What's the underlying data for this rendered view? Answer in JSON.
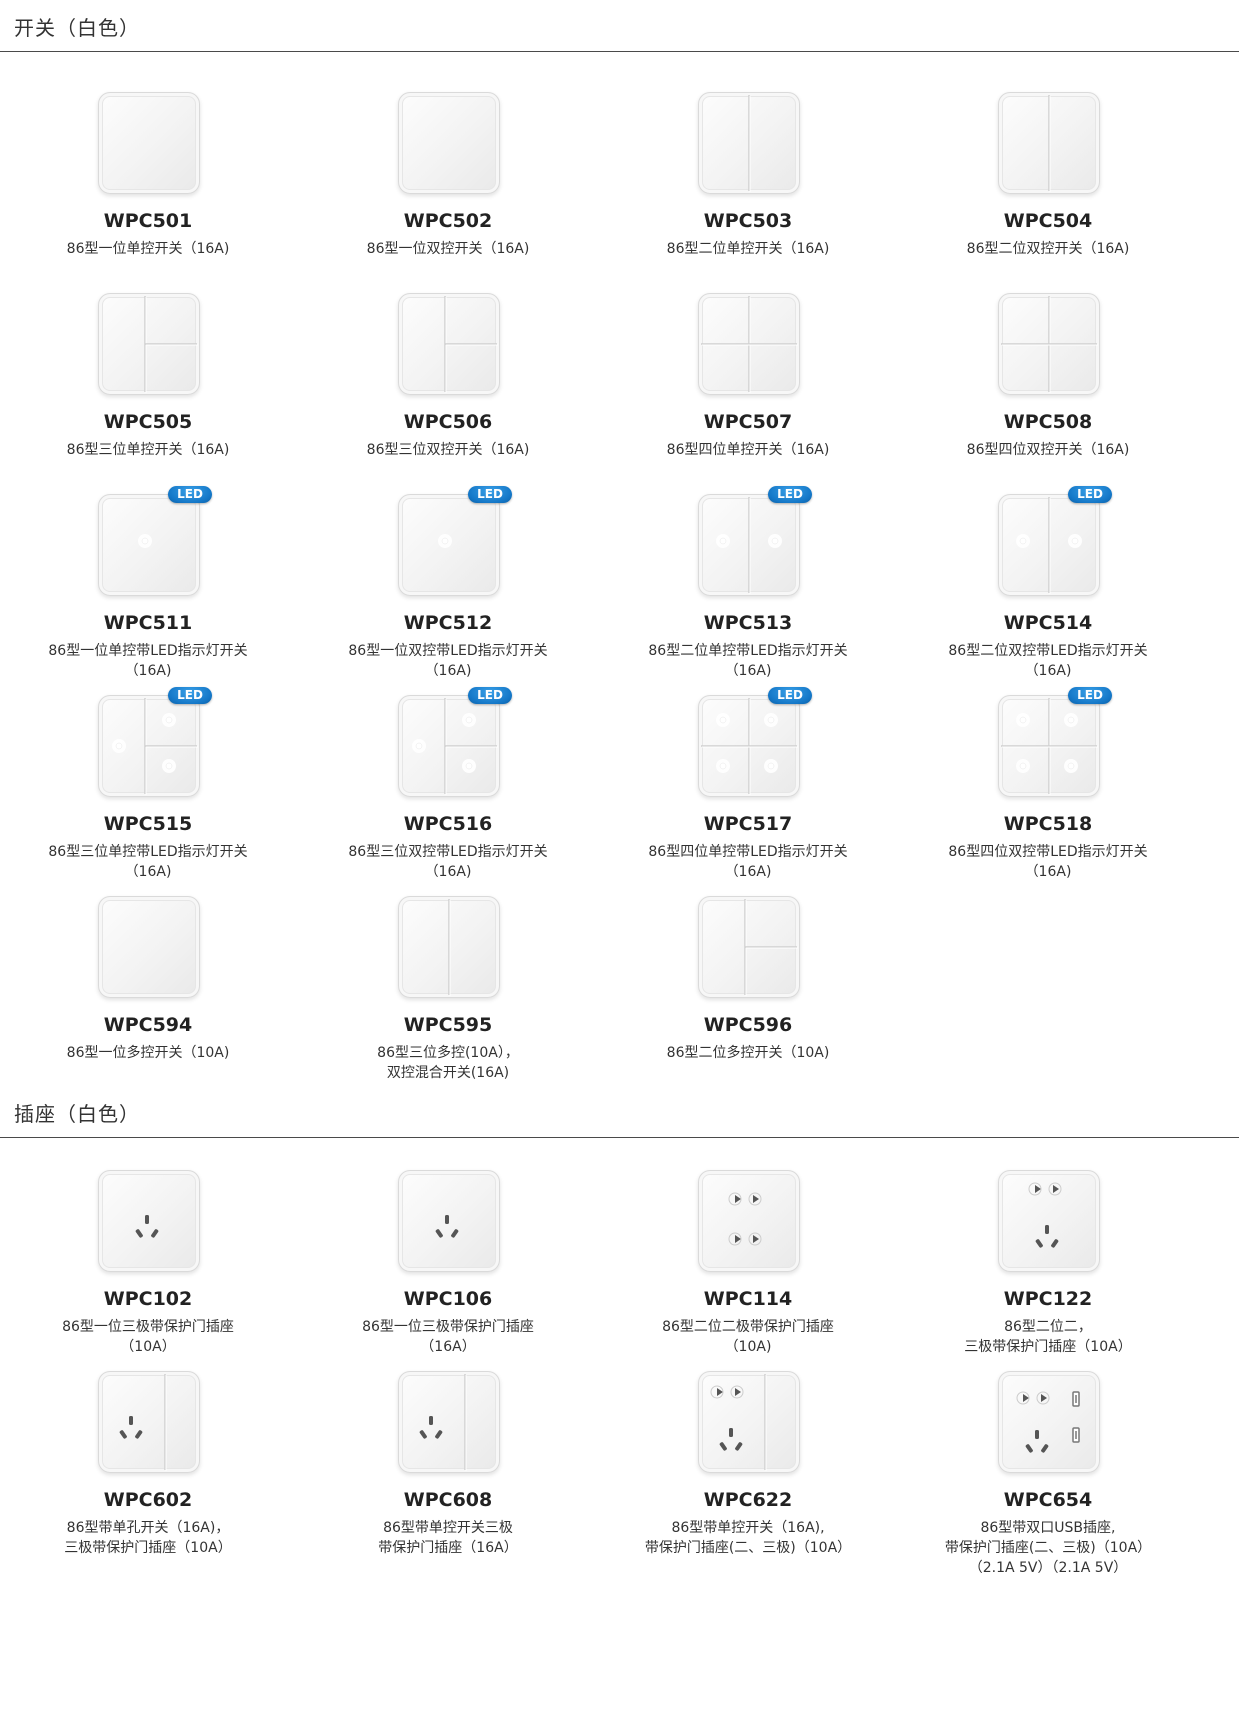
{
  "sections": [
    {
      "title": "开关（白色）",
      "products": [
        {
          "model": "WPC501",
          "desc": "86型一位单控开关（16A)",
          "led": false,
          "icon": "switch-1gang-icon"
        },
        {
          "model": "WPC502",
          "desc": "86型一位双控开关（16A)",
          "led": false,
          "icon": "switch-1gang-icon"
        },
        {
          "model": "WPC503",
          "desc": "86型二位单控开关（16A)",
          "led": false,
          "icon": "switch-2gang-icon"
        },
        {
          "model": "WPC504",
          "desc": "86型二位双控开关（16A)",
          "led": false,
          "icon": "switch-2gang-icon"
        },
        {
          "model": "WPC505",
          "desc": "86型三位单控开关（16A)",
          "led": false,
          "icon": "switch-3gang-icon"
        },
        {
          "model": "WPC506",
          "desc": "86型三位双控开关（16A)",
          "led": false,
          "icon": "switch-3gang-icon"
        },
        {
          "model": "WPC507",
          "desc": "86型四位单控开关（16A)",
          "led": false,
          "icon": "switch-4gang-icon"
        },
        {
          "model": "WPC508",
          "desc": "86型四位双控开关（16A)",
          "led": false,
          "icon": "switch-4gang-icon"
        },
        {
          "model": "WPC511",
          "desc": "86型一位单控带LED指示灯开关\n（16A)",
          "led": true,
          "icon": "switch-1gang-led-icon"
        },
        {
          "model": "WPC512",
          "desc": "86型一位双控带LED指示灯开关\n（16A)",
          "led": true,
          "icon": "switch-1gang-led-icon"
        },
        {
          "model": "WPC513",
          "desc": "86型二位单控带LED指示灯开关\n（16A)",
          "led": true,
          "icon": "switch-2gang-led-icon"
        },
        {
          "model": "WPC514",
          "desc": "86型二位双控带LED指示灯开关\n（16A)",
          "led": true,
          "icon": "switch-2gang-led-icon"
        },
        {
          "model": "WPC515",
          "desc": "86型三位单控带LED指示灯开关\n（16A)",
          "led": true,
          "icon": "switch-3gang-led-icon"
        },
        {
          "model": "WPC516",
          "desc": "86型三位双控带LED指示灯开关\n（16A)",
          "led": true,
          "icon": "switch-3gang-led-icon"
        },
        {
          "model": "WPC517",
          "desc": "86型四位单控带LED指示灯开关\n（16A)",
          "led": true,
          "icon": "switch-4gang-led-icon"
        },
        {
          "model": "WPC518",
          "desc": "86型四位双控带LED指示灯开关\n（16A)",
          "led": true,
          "icon": "switch-4gang-led-icon"
        },
        {
          "model": "WPC594",
          "desc": "86型一位多控开关（10A)",
          "led": false,
          "icon": "switch-1gang-icon"
        },
        {
          "model": "WPC595",
          "desc": "86型三位多控(10A），\n双控混合开关(16A)",
          "led": false,
          "icon": "switch-2gang-icon"
        },
        {
          "model": "WPC596",
          "desc": "86型二位多控开关（10A)",
          "led": false,
          "icon": "switch-3gang-icon"
        }
      ]
    },
    {
      "title": "插座（白色）",
      "products": [
        {
          "model": "WPC102",
          "desc": "86型一位三极带保护门插座\n（10A）",
          "led": false,
          "icon": "socket-3pin-icon"
        },
        {
          "model": "WPC106",
          "desc": "86型一位三极带保护门插座\n（16A）",
          "led": false,
          "icon": "socket-3pin-icon"
        },
        {
          "model": "WPC114",
          "desc": "86型二位二极带保护门插座\n（10A)",
          "led": false,
          "icon": "socket-2x2pin-icon"
        },
        {
          "model": "WPC122",
          "desc": "86型二位二，\n三极带保护门插座（10A）",
          "led": false,
          "icon": "socket-2pin-3pin-icon"
        },
        {
          "model": "WPC602",
          "desc": "86型带单孔开关（16A)，\n三极带保护门插座（10A）",
          "led": false,
          "icon": "switch-socket-3pin-icon"
        },
        {
          "model": "WPC608",
          "desc": "86型带单控开关三极\n带保护门插座（16A）",
          "led": false,
          "icon": "switch-socket-3pin-icon"
        },
        {
          "model": "WPC622",
          "desc": "86型带单控开关（16A),\n带保护门插座(二、三极)（10A）",
          "led": false,
          "icon": "switch-socket-5pin-icon"
        },
        {
          "model": "WPC654",
          "desc": "86型带双口USB插座,\n带保护门插座(二、三极)（10A）\n（2.1A 5V）（2.1A 5V）",
          "led": false,
          "icon": "usb-socket-5pin-icon"
        }
      ]
    }
  ],
  "led_label": "LED"
}
